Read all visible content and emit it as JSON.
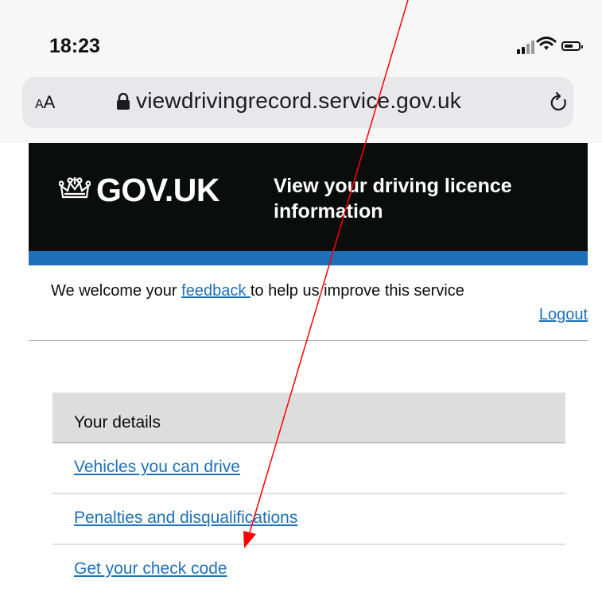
{
  "status_bar": {
    "time": "18:23"
  },
  "browser": {
    "text_size_label_small": "A",
    "text_size_label_large": "A",
    "url": "viewdrivingrecord.service.gov.uk"
  },
  "header": {
    "logo_text": "GOV.UK",
    "service_name": "View your driving licence information"
  },
  "feedback": {
    "before": "We welcome your ",
    "link": "feedback ",
    "after": "to help us improve this service"
  },
  "logout_label": "Logout",
  "nav": {
    "current": "Your details",
    "items": [
      {
        "label": "Vehicles you can drive"
      },
      {
        "label": "Penalties and disqualifications"
      },
      {
        "label": "Get your check code"
      }
    ]
  },
  "colors": {
    "gov_black": "#0b0c0c",
    "gov_blue": "#1d70b8",
    "annotation_red": "#ff0000"
  }
}
